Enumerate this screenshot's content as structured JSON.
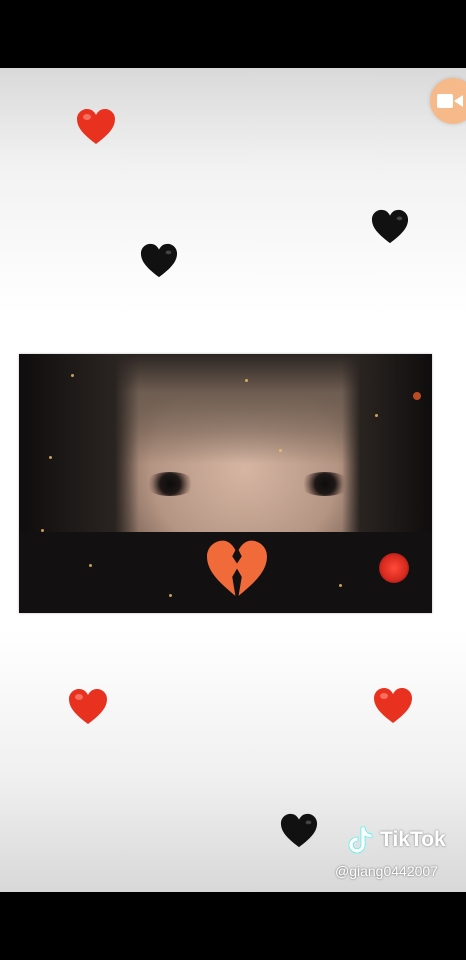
{
  "app": {
    "name": "TikTok"
  },
  "watermark": {
    "logo_text": "TikTok",
    "handle": "@giang0442007"
  },
  "icons": {
    "record": "video-camera-icon",
    "hearts_red": "red-heart-icon",
    "hearts_black": "black-heart-icon",
    "broken": "broken-heart-icon"
  },
  "colors": {
    "red_heart": "#e8321f",
    "black_heart": "#111111",
    "record_button": "#f5b98a",
    "broken_heart": "#f06a3a"
  }
}
